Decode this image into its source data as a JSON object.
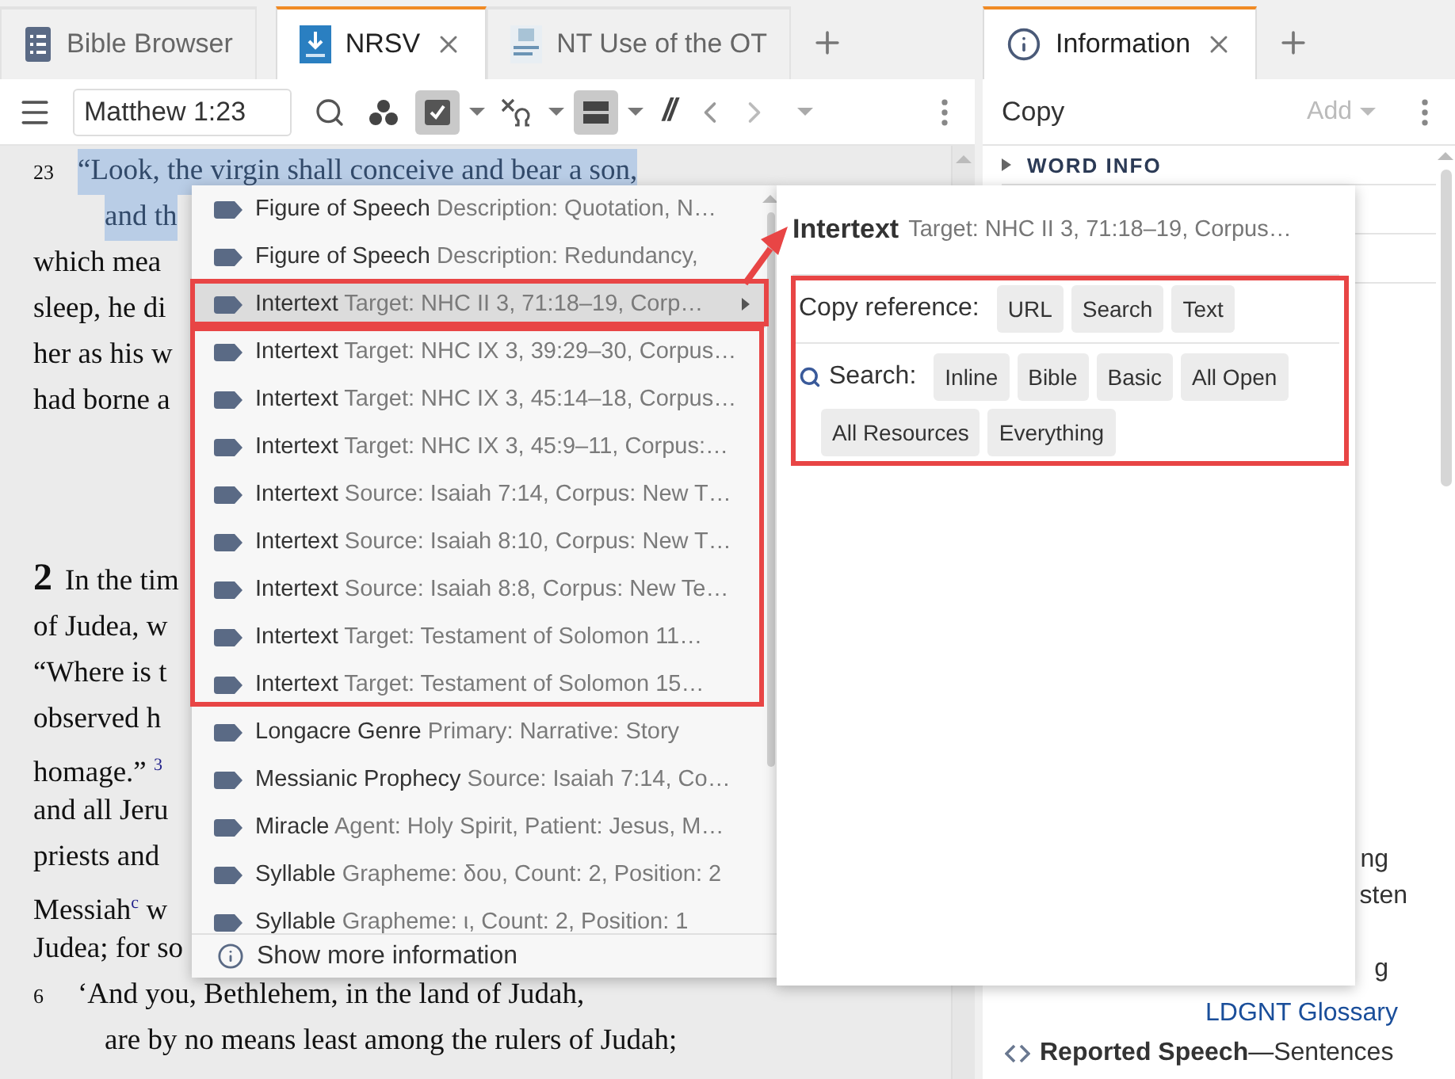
{
  "left_tabs": [
    {
      "label": "Bible Browser",
      "kind": "browser",
      "selected": false,
      "closable": false
    },
    {
      "label": "NRSV",
      "kind": "resource",
      "selected": true,
      "closable": true
    },
    {
      "label": "NT Use of the OT",
      "kind": "document",
      "selected": false,
      "closable": false
    }
  ],
  "reader_toolbar": {
    "reference": "Matthew 1:23",
    "parallel": "//",
    "tools": [
      {
        "kind": "highlight",
        "active": true
      },
      {
        "kind": "interlinear",
        "active": false
      },
      {
        "kind": "layout",
        "active": true
      }
    ]
  },
  "reader_lines": [
    {
      "kind": "verse",
      "verse": "23",
      "text": "“Look, the virgin shall conceive and bear a son,",
      "highlighted": true
    },
    {
      "kind": "indented",
      "text": "and th",
      "highlighted": true
    },
    {
      "kind": "line",
      "text": "which  mea",
      "highlighted": false
    },
    {
      "kind": "line",
      "text": "sleep, he di",
      "highlighted": false
    },
    {
      "kind": "line",
      "text": "her as his w",
      "highlighted": false
    },
    {
      "kind": "line",
      "text": "had borne a",
      "highlighted": false
    },
    {
      "kind": "chapter",
      "verse": "2",
      "text": "In the tim",
      "highlighted": false
    },
    {
      "kind": "line",
      "text": "of Judea, w",
      "highlighted": false
    },
    {
      "kind": "line",
      "text": "“Where is t",
      "highlighted": false
    },
    {
      "kind": "line",
      "text": "observed  h",
      "highlighted": false
    },
    {
      "kind": "line",
      "text": "homage.” $^{3}$",
      "highlighted": false
    },
    {
      "kind": "line",
      "text": "and all Jeru",
      "highlighted": false
    },
    {
      "kind": "line",
      "text": "priests and",
      "highlighted": false
    },
    {
      "kind": "line",
      "text": "Messiah$^{c}$  w",
      "highlighted": false
    },
    {
      "kind": "line",
      "text": "Judea; for so",
      "highlighted": false
    },
    {
      "kind": "verse",
      "verse": "6",
      "text": "‘And you, Bethlehem, in the land of Judah,",
      "highlighted": false
    },
    {
      "kind": "indented",
      "text": "are by no means least among the rulers of Judah;",
      "highlighted": false
    }
  ],
  "context_menu": {
    "items": [
      {
        "name": "Figure of Speech",
        "detail": "Description: Quotation, N…",
        "selected": false,
        "submenu": false
      },
      {
        "name": "Figure of Speech",
        "detail": "Description: Redundancy,",
        "selected": false,
        "submenu": false
      },
      {
        "name": "Intertext",
        "detail": "Target: NHC II 3, 71:18–19, Corp…",
        "selected": true,
        "submenu": true
      },
      {
        "name": "Intertext",
        "detail": "Target: NHC IX 3, 39:29–30, Corpus…",
        "selected": false,
        "submenu": false
      },
      {
        "name": "Intertext",
        "detail": "Target: NHC IX 3, 45:14–18, Corpus…",
        "selected": false,
        "submenu": false
      },
      {
        "name": "Intertext",
        "detail": "Target: NHC IX 3, 45:9–11, Corpus:…",
        "selected": false,
        "submenu": false
      },
      {
        "name": "Intertext",
        "detail": "Source: Isaiah 7:14, Corpus: New T…",
        "selected": false,
        "submenu": false
      },
      {
        "name": "Intertext",
        "detail": "Source: Isaiah 8:10, Corpus: New T…",
        "selected": false,
        "submenu": false
      },
      {
        "name": "Intertext",
        "detail": "Source: Isaiah 8:8, Corpus: New Te…",
        "selected": false,
        "submenu": false
      },
      {
        "name": "Intertext",
        "detail": "Target: Testament of Solomon 11…",
        "selected": false,
        "submenu": false
      },
      {
        "name": "Intertext",
        "detail": "Target: Testament of Solomon 15…",
        "selected": false,
        "submenu": false
      },
      {
        "name": "Longacre Genre",
        "detail": "Primary: Narrative: Story",
        "selected": false,
        "submenu": false
      },
      {
        "name": "Messianic Prophecy",
        "detail": "Source: Isaiah 7:14, Co…",
        "selected": false,
        "submenu": false
      },
      {
        "name": "Miracle",
        "detail": "Agent: Holy Spirit, Patient: Jesus, M…",
        "selected": false,
        "submenu": false
      },
      {
        "name": "Syllable",
        "detail": "Grapheme: δου, Count: 2, Position: 2",
        "selected": false,
        "submenu": false
      },
      {
        "name": "Syllable",
        "detail": "Grapheme: ι, Count: 2, Position: 1",
        "selected": false,
        "submenu": false
      }
    ],
    "footer": "Show more information"
  },
  "submenu": {
    "name": "Intertext",
    "detail": "Target: NHC II 3, 71:18–19, Corpus…",
    "copy_label": "Copy reference:",
    "copy_options": [
      "URL",
      "Search",
      "Text"
    ],
    "search_label": "Search:",
    "search_options": [
      "Inline",
      "Bible",
      "Basic",
      "All Open",
      "All Resources",
      "Everything"
    ]
  },
  "info_panel": {
    "tab": {
      "label": "Information",
      "selected": true
    },
    "copy": "Copy",
    "add": {
      "label": "Add",
      "disabled": true
    },
    "section": {
      "title": "WORD INFO",
      "expanded": false
    },
    "fragments": [
      "ng",
      "sten",
      "g"
    ],
    "glossary_link": "LDGNT Glossary",
    "entry": {
      "term": "Reported Speech",
      "text": "—Sentences"
    }
  }
}
